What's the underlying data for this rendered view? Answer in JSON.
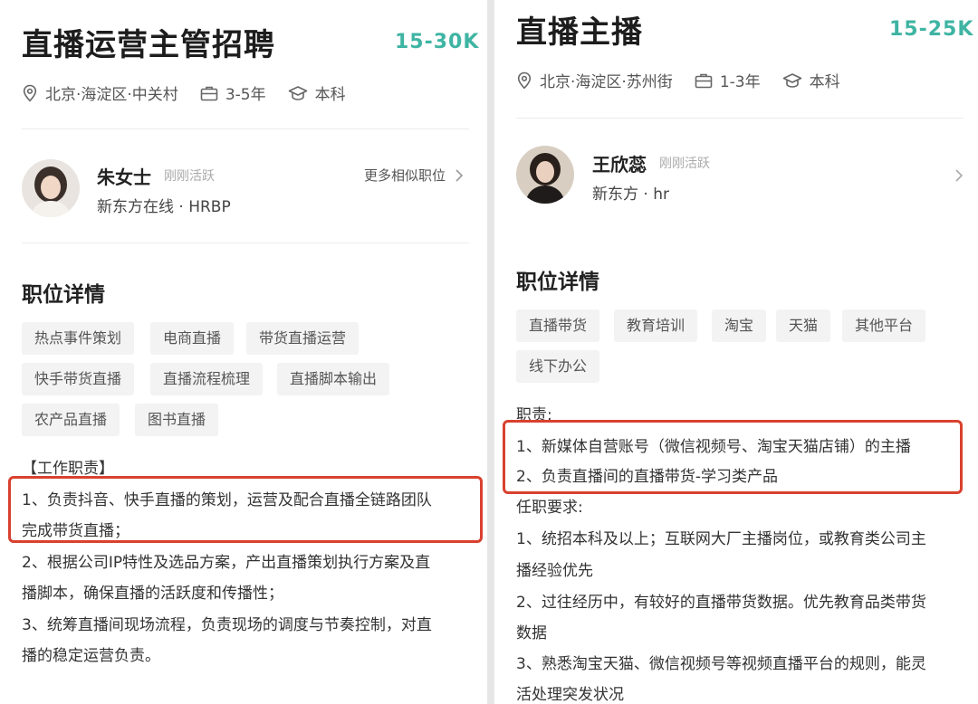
{
  "left": {
    "title": "直播运营主管招聘",
    "salary": "15-30K",
    "location": "北京·海淀区·中关村",
    "experience": "3-5年",
    "education": "本科",
    "recruiter": {
      "name": "朱女士",
      "status": "刚刚活跃",
      "company": "新东方在线 · HRBP",
      "more_link": "更多相似职位"
    },
    "section_title": "职位详情",
    "tags": [
      "热点事件策划",
      "电商直播",
      "带货直播运营",
      "快手带货直播",
      "直播流程梳理",
      "直播脚本输出",
      "农产品直播",
      "图书直播"
    ],
    "lines": [
      "【工作职责】",
      "1、负责抖音、快手直播的策划，运营及配合直播全链路团队",
      "完成带货直播；",
      "2、根据公司IP特性及选品方案，产出直播策划执行方案及直",
      "播脚本，确保直播的活跃度和传播性；",
      "3、统筹直播间现场流程，负责现场的调度与节奏控制，对直",
      "播的稳定运营负责。"
    ]
  },
  "right": {
    "title": "直播主播",
    "salary": "15-25K",
    "location": "北京·海淀区·苏州街",
    "experience": "1-3年",
    "education": "本科",
    "recruiter": {
      "name": "王欣蕊",
      "status": "刚刚活跃",
      "company": "新东方 · hr"
    },
    "section_title": "职位详情",
    "tags": [
      "直播带货",
      "教育培训",
      "淘宝",
      "天猫",
      "其他平台",
      "线下办公"
    ],
    "lines": [
      "职责:",
      "1、新媒体自营账号（微信视频号、淘宝天猫店铺）的主播",
      "2、负责直播间的直播带货-学习类产品",
      "任职要求:",
      "1、统招本科及以上；互联网大厂主播岗位，或教育类公司主",
      "播经验优先",
      "2、过往经历中，有较好的直播带货数据。优先教育品类带货",
      "数据",
      "3、熟悉淘宝天猫、微信视频号等视频直播平台的规则，能灵",
      "活处理突发状况"
    ]
  },
  "colors": {
    "salary": "#3fb4a3",
    "highlight": "#d9412f",
    "tag_bg": "#f3f3f3"
  },
  "icons": [
    "location-pin-icon",
    "briefcase-icon",
    "graduation-cap-icon",
    "chevron-right-icon"
  ]
}
